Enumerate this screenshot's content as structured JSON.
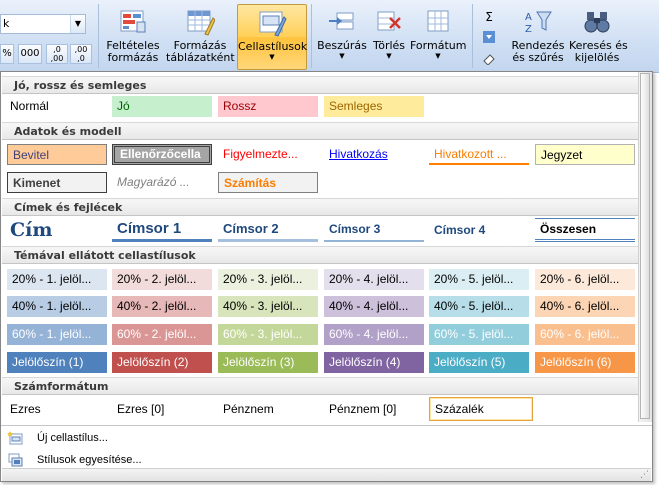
{
  "ribbon": {
    "font_box_value": "k",
    "number": {
      "percent": "%",
      "thousands": "000",
      "inc_dec": ",0 ,00",
      "dec_dec": ",00 ,0"
    },
    "buttons": [
      {
        "id": "conditional",
        "label1": "Feltételes",
        "label2": "formázás"
      },
      {
        "id": "format_table",
        "label1": "Formázás",
        "label2": "táblázatként"
      },
      {
        "id": "cell_styles",
        "label1": "Cellastílusok",
        "label2": ""
      },
      {
        "id": "insert",
        "label1": "Beszúrás",
        "label2": ""
      },
      {
        "id": "delete",
        "label1": "Törlés",
        "label2": ""
      },
      {
        "id": "format",
        "label1": "Formátum",
        "label2": ""
      },
      {
        "id": "sort",
        "label1": "Rendezés",
        "label2": "és szűrés"
      },
      {
        "id": "find",
        "label1": "Keresés és",
        "label2": "kijelölés"
      }
    ],
    "sigma": "Σ"
  },
  "gallery": {
    "sections": [
      {
        "id": "good_bad",
        "title": "Jó, rossz és semleges"
      },
      {
        "id": "data_model",
        "title": "Adatok és modell"
      },
      {
        "id": "titles",
        "title": "Címek és fejlécek"
      },
      {
        "id": "themed",
        "title": "Témával ellátott cellastílusok"
      },
      {
        "id": "numfmt",
        "title": "Számformátum"
      }
    ],
    "good_bad": [
      "Normál",
      "Jó",
      "Rossz",
      "Semleges"
    ],
    "data_model_row1": [
      "Bevitel",
      "Ellenőrzőcella",
      "Figyelmezte...",
      "Hivatkozás",
      "Hivatkozott ...",
      "Jegyzet"
    ],
    "data_model_row2": [
      "Kimenet",
      "Magyarázó ...",
      "Számítás"
    ],
    "titles": [
      "Cím",
      "Címsor 1",
      "Címsor 2",
      "Címsor 3",
      "Címsor 4",
      "Összesen"
    ],
    "themed_20": [
      "20% - 1. jelöl...",
      "20% - 2. jelöl...",
      "20% - 3. jelöl...",
      "20% - 4. jelöl...",
      "20% - 5. jelöl...",
      "20% - 6. jelöl..."
    ],
    "themed_40": [
      "40% - 1. jelöl...",
      "40% - 2. jelöl...",
      "40% - 3. jelöl...",
      "40% - 4. jelöl...",
      "40% - 5. jelöl...",
      "40% - 6. jelöl..."
    ],
    "themed_60": [
      "60% - 1. jelöl...",
      "60% - 2. jelöl...",
      "60% - 3. jelöl...",
      "60% - 4. jelöl...",
      "60% - 5. jelöl...",
      "60% - 6. jelöl..."
    ],
    "themed_accent": [
      "Jelölőszín (1)",
      "Jelölőszín (2)",
      "Jelölőszín (3)",
      "Jelölőszín (4)",
      "Jelölőszín (5)",
      "Jelölőszín (6)"
    ],
    "numfmt": [
      "Ezres",
      "Ezres [0]",
      "Pénznem",
      "Pénznem [0]",
      "Százalék"
    ],
    "menu": [
      {
        "id": "new_style",
        "label": "Új cellastílus..."
      },
      {
        "id": "merge_styles",
        "label": "Stílusok egyesítése..."
      }
    ]
  },
  "colors": {
    "good_bg": "#c6efce",
    "good_fg": "#006100",
    "bad_bg": "#ffc7ce",
    "bad_fg": "#9c0006",
    "neutral_bg": "#ffeb9c",
    "neutral_fg": "#9c6500",
    "input_bg": "#ffcc99",
    "input_fg": "#3f3f76",
    "check_bg": "#a5a5a5",
    "warn_fg": "#ff0000",
    "link_fg": "#0000ff",
    "linked_fg": "#fa7d00",
    "note_bg": "#ffffcc",
    "output_bg": "#f2f2f2",
    "output_fg": "#3f3f3f",
    "explain_fg": "#7f7f7f",
    "calc_fg": "#fa7d00",
    "title_fg": "#1f497d",
    "accent": [
      "#4f81bd",
      "#c0504d",
      "#9bbb59",
      "#8064a2",
      "#4bacc6",
      "#f79646"
    ],
    "accent20": [
      "#dce6f1",
      "#f2dcdb",
      "#ebf1de",
      "#e4dfec",
      "#daeef3",
      "#fde9d9"
    ],
    "accent40": [
      "#b8cce4",
      "#e6b8b7",
      "#d8e4bc",
      "#ccc0da",
      "#b7dee8",
      "#fcd5b4"
    ],
    "accent60": [
      "#95b3d7",
      "#da9694",
      "#c4d79b",
      "#b1a0c7",
      "#92cddc",
      "#fabf8f"
    ],
    "ribbon_active": "#ffd058"
  }
}
